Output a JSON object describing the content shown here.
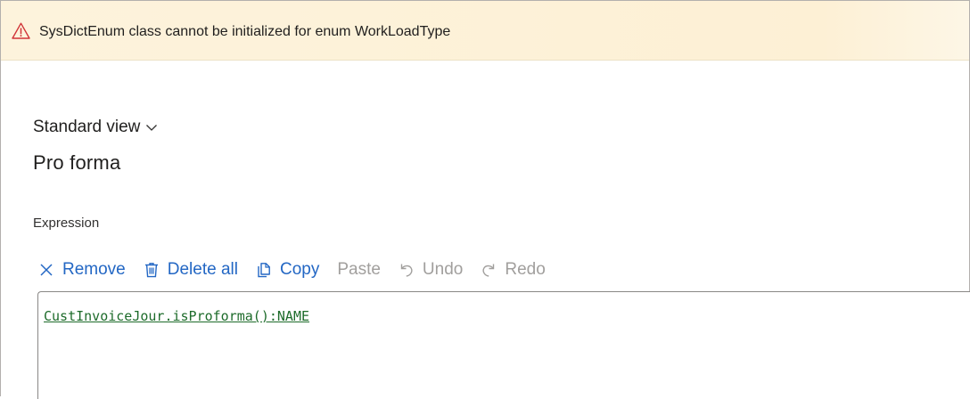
{
  "warning": {
    "icon": "warning-triangle-icon",
    "message": "SysDictEnum class cannot be initialized for enum WorkLoadType",
    "icon_color": "#d13438",
    "background": "#fdf3dc"
  },
  "view": {
    "selector_label": "Standard view",
    "selector_icon": "chevron-down-icon"
  },
  "page": {
    "title": "Pro forma"
  },
  "expression": {
    "label": "Expression",
    "toolbar": {
      "remove_label": "Remove",
      "remove_icon": "close-icon",
      "delete_all_label": "Delete all",
      "delete_all_icon": "trash-icon",
      "copy_label": "Copy",
      "copy_icon": "copy-icon",
      "paste_label": "Paste",
      "undo_label": "Undo",
      "undo_icon": "undo-icon",
      "redo_label": "Redo",
      "redo_icon": "redo-icon"
    },
    "value": "CustInvoiceJour.isProforma():NAME"
  },
  "colors": {
    "accent": "#2367c4",
    "disabled": "#a19f9d",
    "expression_text": "#1d6b2a"
  }
}
